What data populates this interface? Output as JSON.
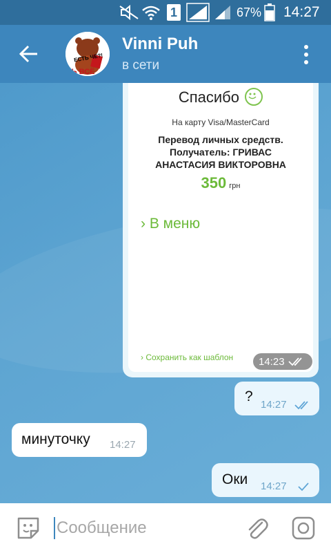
{
  "status_bar": {
    "sim_slot": "1",
    "battery": "67%",
    "time": "14:27"
  },
  "header": {
    "contact_name": "Vinni Puh",
    "status": "в сети",
    "avatar_text_top": "ЕСТЬ ЧЕ?!",
    "avatar_text_bottom": "ТЬ ВСЁ"
  },
  "receipt": {
    "thanks": "Спасибо",
    "card_line": "На карту Visa/MasterCard",
    "line1": "Перевод личных средств.",
    "line2": "Получатель: ГРИВАС",
    "line3": "АНАСТАСИЯ ВИКТОРОВНА",
    "amount": "350",
    "currency": "грн",
    "menu_link": "В меню",
    "save_link": "Сохранить как шаблон",
    "time": "14:23"
  },
  "messages": [
    {
      "direction": "out",
      "text": "?",
      "time": "14:27",
      "status": "read"
    },
    {
      "direction": "in",
      "text": "минуточку",
      "time": "14:27"
    },
    {
      "direction": "out",
      "text": "Оки",
      "time": "14:27",
      "status": "sent"
    }
  ],
  "input": {
    "placeholder": "Сообщение"
  },
  "colors": {
    "header": "#3d86bd",
    "status_bar": "#2f6e9c",
    "accent_green": "#6cba3a",
    "outgoing_bubble": "#eaf6fd"
  }
}
